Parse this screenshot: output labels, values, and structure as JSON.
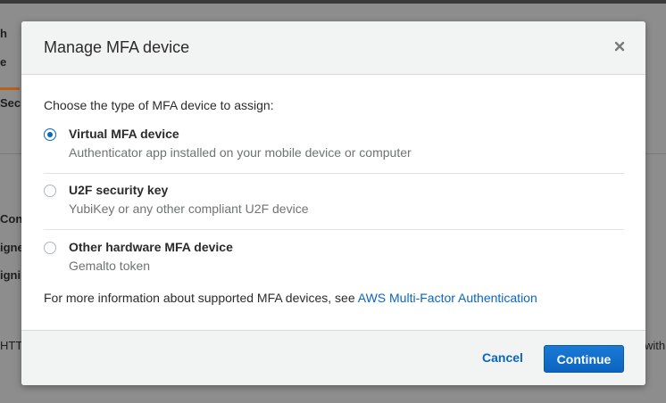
{
  "background": {
    "fragments": [
      "h",
      "e",
      "Sec",
      "Cons",
      "igne",
      "igni",
      "HTT",
      "with a"
    ]
  },
  "modal": {
    "title": "Manage MFA device",
    "close_icon": "close-icon",
    "prompt": "Choose the type of MFA device to assign:",
    "options": [
      {
        "label": "Virtual MFA device",
        "description": "Authenticator app installed on your mobile device or computer",
        "selected": true
      },
      {
        "label": "U2F security key",
        "description": "YubiKey or any other compliant U2F device",
        "selected": false
      },
      {
        "label": "Other hardware MFA device",
        "description": "Gemalto token",
        "selected": false
      }
    ],
    "info_text": "For more information about supported MFA devices, see ",
    "info_link": "AWS Multi-Factor Authentication",
    "cancel_label": "Cancel",
    "continue_label": "Continue"
  },
  "colors": {
    "accent": "#0a66c2",
    "header_bg": "#f2f3f3"
  }
}
